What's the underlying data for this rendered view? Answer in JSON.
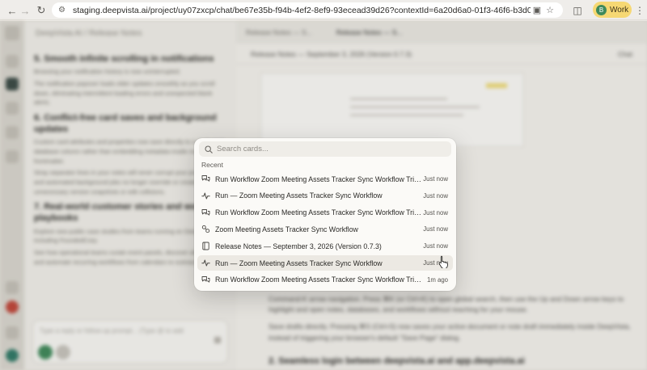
{
  "browser": {
    "url": "staging.deepvista.ai/project/uy07zxcp/chat/be67e35b-f94b-4ef2-8ef9-93ecead39d26?contextId=6a20d6a0-01f3-46f6-b3d0-19b60023e2a7&c...",
    "profile_label": "Work",
    "profile_initial": "B"
  },
  "chat_panel": {
    "header": "DeepVista AI / Release Notes",
    "headings": [
      "5. Smooth infinite scrolling in notifications",
      "6. Conflict-free card saves and background updates",
      "7. Real-world customer stories and workflow playbooks"
    ],
    "paragraphs": [
      "Browsing your notification history is now uninterrupted.",
      "The notification popover loads older updates smoothly as you scroll down, eliminating intermittent loading errors and unexpected blank alerts.",
      "Custom card attributes and properties now save directly to a dedicated database column rather than embedding metadata inside markdown frontmatter.",
      "Stray separator lines in your notes will never corrupt your properties, and automated background jobs no longer override or create unnecessary version snapshots or edit collisions.",
      "Explore new public case studies from teams running on DeepVista, including FoundedCorp.",
      "See how operational teams curate event panels, discover attendees, and automate recurring workflows from calendars to outreach."
    ],
    "composer_placeholder": "Type a reply or follow-up prompt... (Type @ to add"
  },
  "doc_panel": {
    "tabs": [
      "Release Notes — S...",
      "Release Notes — S..."
    ],
    "toolbar_title": "Release Notes — September 3, 2026 (Version 0.7.3)",
    "toolbar_right": "Chat",
    "bullets": [
      "Command-K arrow navigation. Press ⌘K (or Ctrl+K) to open global search, then use the Up and Down arrow keys to highlight and open notes, databases, and workflows without reaching for your mouse.",
      "Save drafts directly. Pressing ⌘S (Ctrl+S) now saves your active document or note draft immediately inside DeepVista, instead of triggering your browser's default \"Save Page\" dialog."
    ],
    "next_section": "2. Seamless login between deepvista.ai and app.deepvista.ai"
  },
  "palette": {
    "search_placeholder": "Search cards...",
    "section_label": "Recent",
    "items": [
      {
        "icon": "chat-bubbles-icon",
        "title": "Run Workflow Zoom Meeting Assets Tracker Sync Workflow Triggered by:",
        "time": "Just now"
      },
      {
        "icon": "activity-pulse-icon",
        "title": "Run — Zoom Meeting Assets Tracker Sync Workflow",
        "time": "Just now"
      },
      {
        "icon": "chat-bubbles-icon",
        "title": "Run Workflow Zoom Meeting Assets Tracker Sync Workflow Triggered by:",
        "time": "Just now"
      },
      {
        "icon": "workflow-link-icon",
        "title": "Zoom Meeting Assets Tracker Sync Workflow",
        "time": "Just now"
      },
      {
        "icon": "document-icon",
        "title": "Release Notes — September 3, 2026 (Version 0.7.3)",
        "time": "Just now"
      },
      {
        "icon": "activity-pulse-icon",
        "title": "Run — Zoom Meeting Assets Tracker Sync Workflow",
        "time": "Just now"
      },
      {
        "icon": "chat-bubbles-icon",
        "title": "Run Workflow Zoom Meeting Assets Tracker Sync Workflow Triggered by:",
        "time": "1m ago"
      }
    ]
  }
}
